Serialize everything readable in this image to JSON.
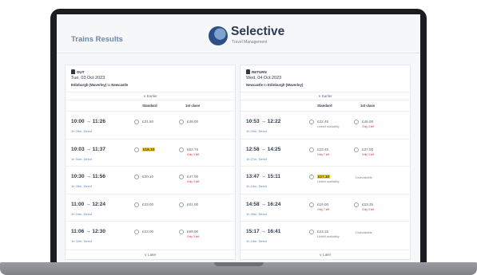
{
  "header": {
    "title": "Trains Results",
    "logo": {
      "name": "Selective",
      "tagline": "Travel Management"
    }
  },
  "labels": {
    "earlier": "∧ Earlier",
    "later": "∨ Later",
    "standard": "Standard",
    "first_class": "1st class"
  },
  "outbound": {
    "label": "OUT",
    "date": "Tue, 03 Oct 2023",
    "route_from": "Edinburgh (Waverley)",
    "route_sep": " to ",
    "route_to": "Newcastle",
    "rows": [
      {
        "time": "10:00 → 11:26",
        "dur": "1h 26m, Direct",
        "std": "£31.50",
        "std_hl": false,
        "std_note": "",
        "fst": "£48.00",
        "fst_note": "",
        "fst_unavailable": false
      },
      {
        "time": "10:03 → 11:37",
        "dur": "1h 34m, Direct",
        "std": "£19.10",
        "std_hl": true,
        "std_note": "",
        "fst": "£62.75",
        "fst_note": "Only 3 left",
        "fst_unavailable": false
      },
      {
        "time": "10:30 → 11:56",
        "dur": "1h 26m, Direct",
        "std": "£30.10",
        "std_hl": false,
        "std_note": "",
        "fst": "£47.00",
        "fst_note": "Only 3 left",
        "fst_unavailable": false
      },
      {
        "time": "11:00 → 12:24",
        "dur": "1h 24m, Direct",
        "std": "£33.00",
        "std_hl": false,
        "std_note": "",
        "fst": "£61.00",
        "fst_note": "",
        "fst_unavailable": false
      },
      {
        "time": "11:06 → 12:30",
        "dur": "1h 32m, Direct",
        "std": "£23.00",
        "std_hl": false,
        "std_note": "",
        "fst": "£69.00",
        "fst_note": "Only 3 left",
        "fst_unavailable": false
      }
    ]
  },
  "return": {
    "label": "RETURN",
    "date": "Wed, 04 Oct 2023",
    "route_from": "Newcastle",
    "route_sep": " to ",
    "route_to": "Edinburgh (Waverley)",
    "rows": [
      {
        "time": "10:53 → 12:22",
        "dur": "1h 29m, Direct",
        "std": "£22.45",
        "std_hl": false,
        "std_note": "Limited availability",
        "std_note_red": false,
        "fst": "£46.00",
        "fst_note": "Only 3 left",
        "fst_unavailable": false
      },
      {
        "time": "12:58 → 14:25",
        "dur": "1h 27m, Direct",
        "std": "£23.45",
        "std_hl": false,
        "std_note": "Only 7 left",
        "std_note_red": true,
        "fst": "£37.00",
        "fst_note": "Only 3 left",
        "fst_unavailable": false
      },
      {
        "time": "13:47 → 15:11",
        "dur": "1h 24m, Direct",
        "std": "£17.10",
        "std_hl": true,
        "std_note": "Limited availability",
        "std_note_red": false,
        "fst": "Unavailable",
        "fst_note": "",
        "fst_unavailable": true
      },
      {
        "time": "14:58 → 16:24",
        "dur": "1h 26m, Direct",
        "std": "£19.00",
        "std_hl": false,
        "std_note": "Only 7 left",
        "std_note_red": true,
        "fst": "£33.25",
        "fst_note": "Only 3 left",
        "fst_unavailable": false
      },
      {
        "time": "15:17 → 16:41",
        "dur": "1h 24m, Direct",
        "std": "£23.15",
        "std_hl": false,
        "std_note": "Limited availability",
        "std_note_red": false,
        "fst": "Unavailable",
        "fst_note": "",
        "fst_unavailable": true
      }
    ]
  }
}
